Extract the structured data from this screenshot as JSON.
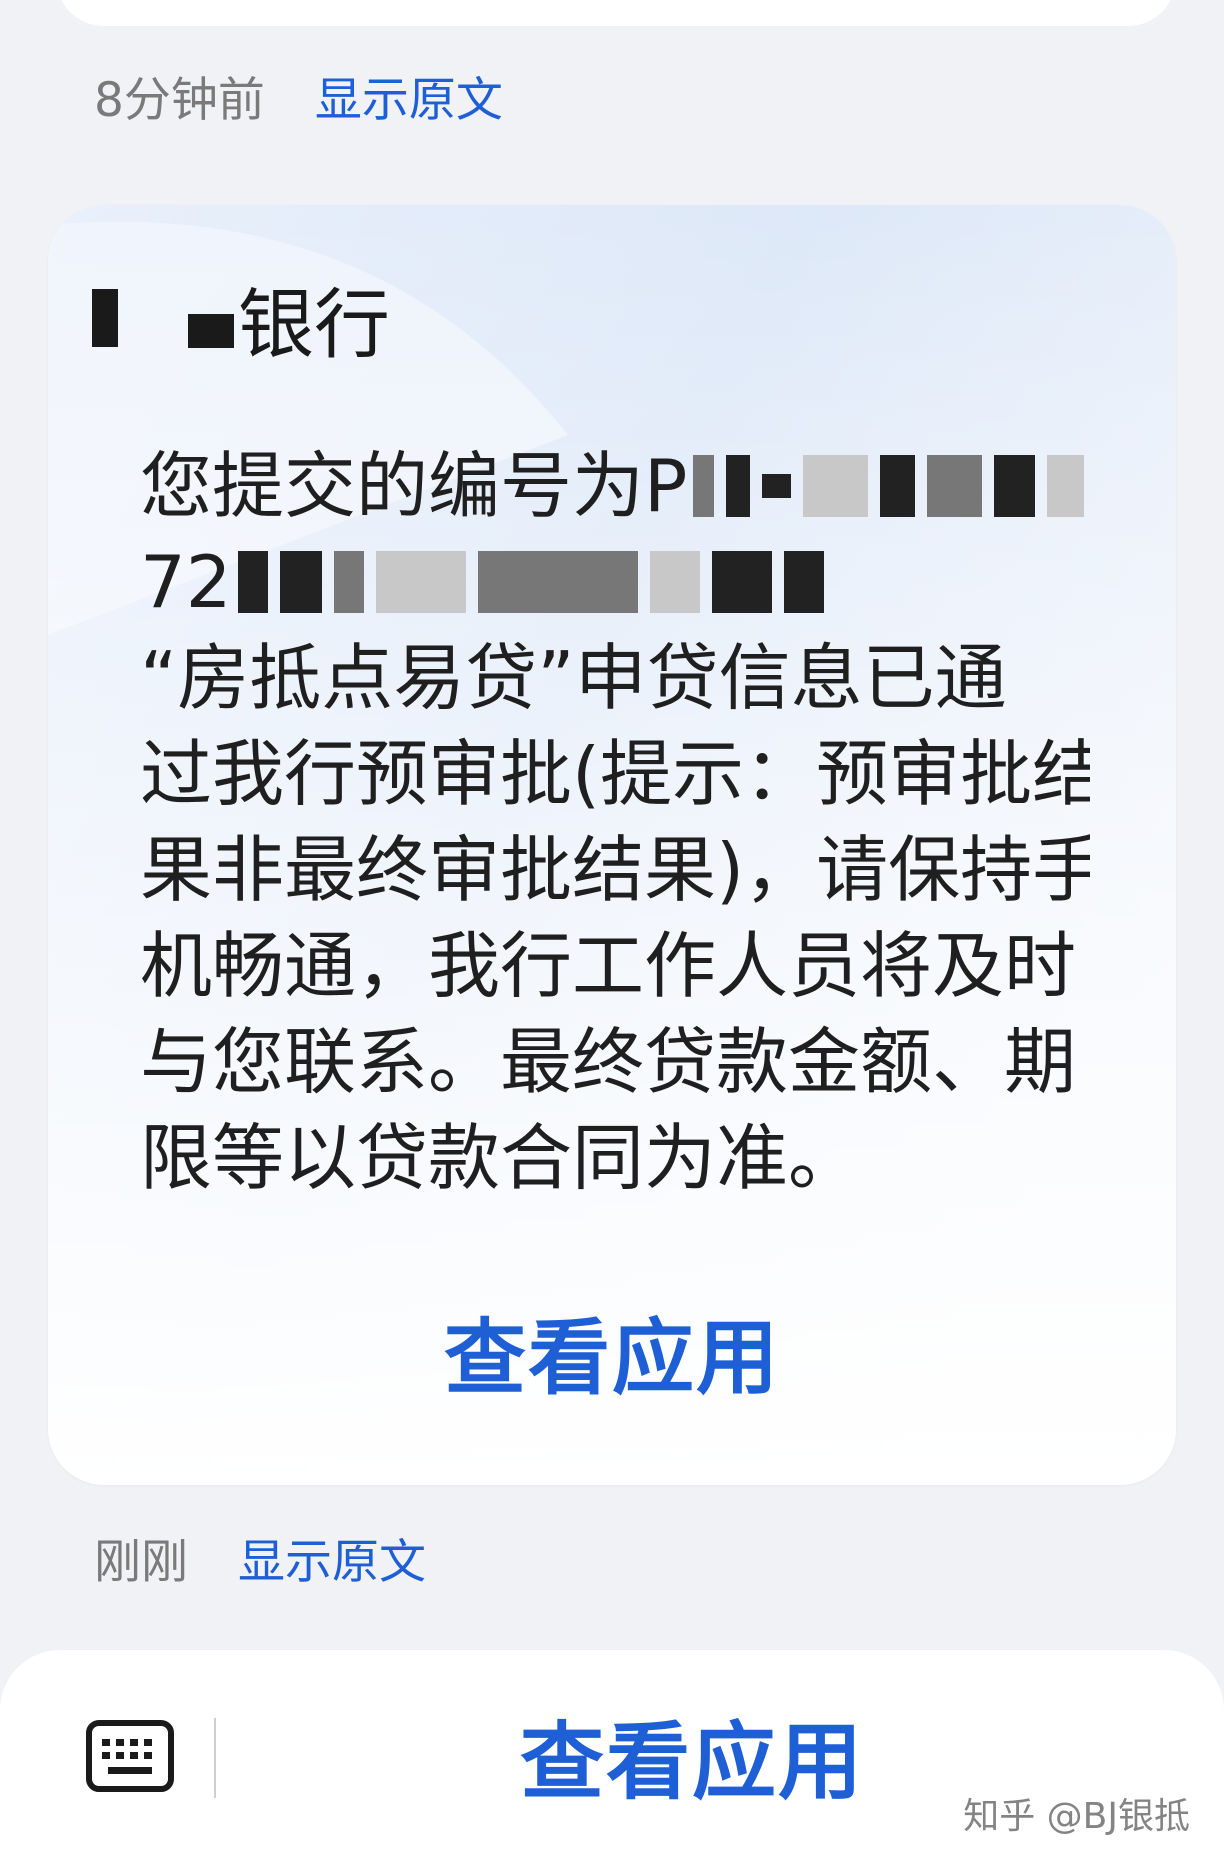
{
  "previous_message": {
    "time": "8分钟前",
    "show_original": "显示原文"
  },
  "card": {
    "sender_suffix": "银行",
    "lines": [
      {
        "prefix": "您提交的编号为P"
      },
      {
        "prefix": "72"
      },
      {
        "text": "“房抵点易贷”申贷信息已通"
      },
      {
        "text": "过我行预审批(提示：预审批结"
      },
      {
        "text": "果非最终审批结果)，请保持手"
      },
      {
        "text": "机畅通，我行工作人员将及时"
      },
      {
        "text": "与您联系。最终贷款金额、期"
      },
      {
        "text": "限等以贷款合同为准。"
      }
    ],
    "action": "查看应用"
  },
  "latest_message": {
    "time": "刚刚",
    "show_original": "显示原文"
  },
  "bottom_bar": {
    "keyboard_icon": "keyboard-icon",
    "action": "查看应用"
  },
  "watermark": "知乎 @BJ银抵",
  "colors": {
    "accent": "#1f5fd6",
    "background": "#f1f2f6",
    "card": "#ffffff"
  }
}
